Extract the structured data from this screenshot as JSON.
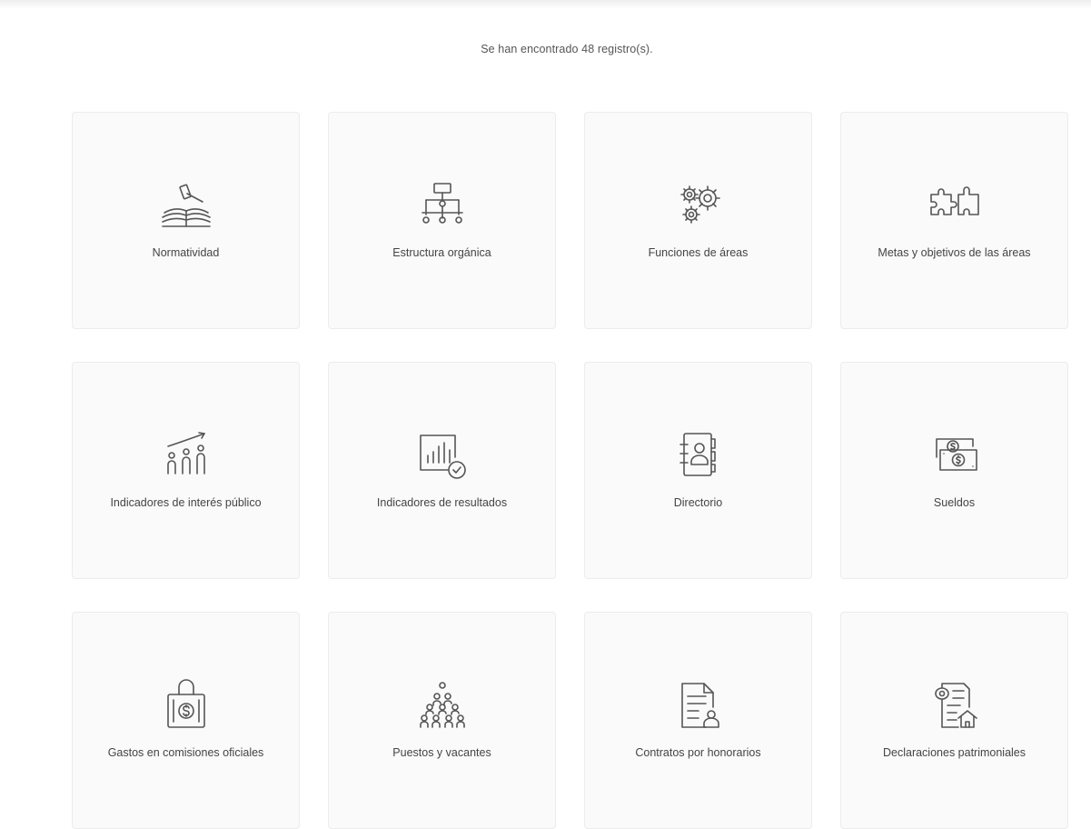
{
  "results": {
    "count_text": "Se han encontrado 48 registro(s)."
  },
  "cards": [
    {
      "label": "Normatividad",
      "icon": "gavel-book-icon"
    },
    {
      "label": "Estructura orgánica",
      "icon": "org-chart-icon"
    },
    {
      "label": "Funciones de áreas",
      "icon": "gears-icon"
    },
    {
      "label": "Metas y objetivos de las áreas",
      "icon": "puzzle-icon"
    },
    {
      "label": "Indicadores de interés público",
      "icon": "people-growth-icon"
    },
    {
      "label": "Indicadores de resultados",
      "icon": "bar-chart-check-icon"
    },
    {
      "label": "Directorio",
      "icon": "address-book-icon"
    },
    {
      "label": "Sueldos",
      "icon": "banknotes-icon"
    },
    {
      "label": "Gastos en comisiones oficiales",
      "icon": "money-bag-icon"
    },
    {
      "label": "Puestos y vacantes",
      "icon": "crowd-icon"
    },
    {
      "label": "Contratos por honorarios",
      "icon": "contract-person-icon"
    },
    {
      "label": "Declaraciones patrimoniales",
      "icon": "declaration-house-icon"
    }
  ],
  "colors": {
    "card_background": "#fafafa",
    "card_border": "#ececec",
    "icon_stroke": "#555555",
    "text": "#444444"
  }
}
